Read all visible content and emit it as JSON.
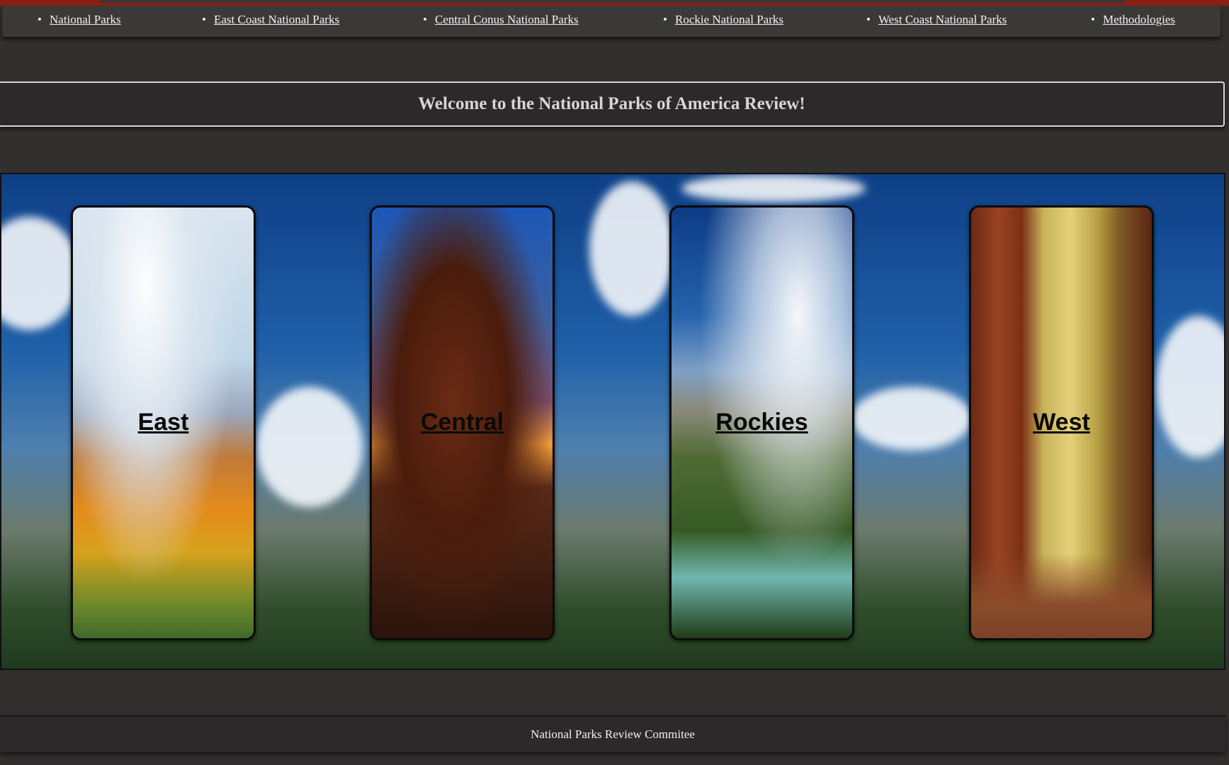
{
  "nav": {
    "items": [
      {
        "label": "National Parks"
      },
      {
        "label": "East Coast National Parks"
      },
      {
        "label": "Central Conus National Parks"
      },
      {
        "label": "Rockie National Parks"
      },
      {
        "label": "West Coast National Parks"
      },
      {
        "label": "Methodologies"
      }
    ]
  },
  "welcome": {
    "title": "Welcome to the National Parks of America Review!"
  },
  "hero": {
    "cards": [
      {
        "label": "East"
      },
      {
        "label": "Central"
      },
      {
        "label": "Rockies"
      },
      {
        "label": "West"
      }
    ]
  },
  "footer": {
    "text": "National Parks Review Commitee"
  },
  "colors": {
    "accent": "#8b1f14",
    "background": "#322f2f",
    "nav_background": "#3b3838",
    "text": "#f2f2f2"
  }
}
